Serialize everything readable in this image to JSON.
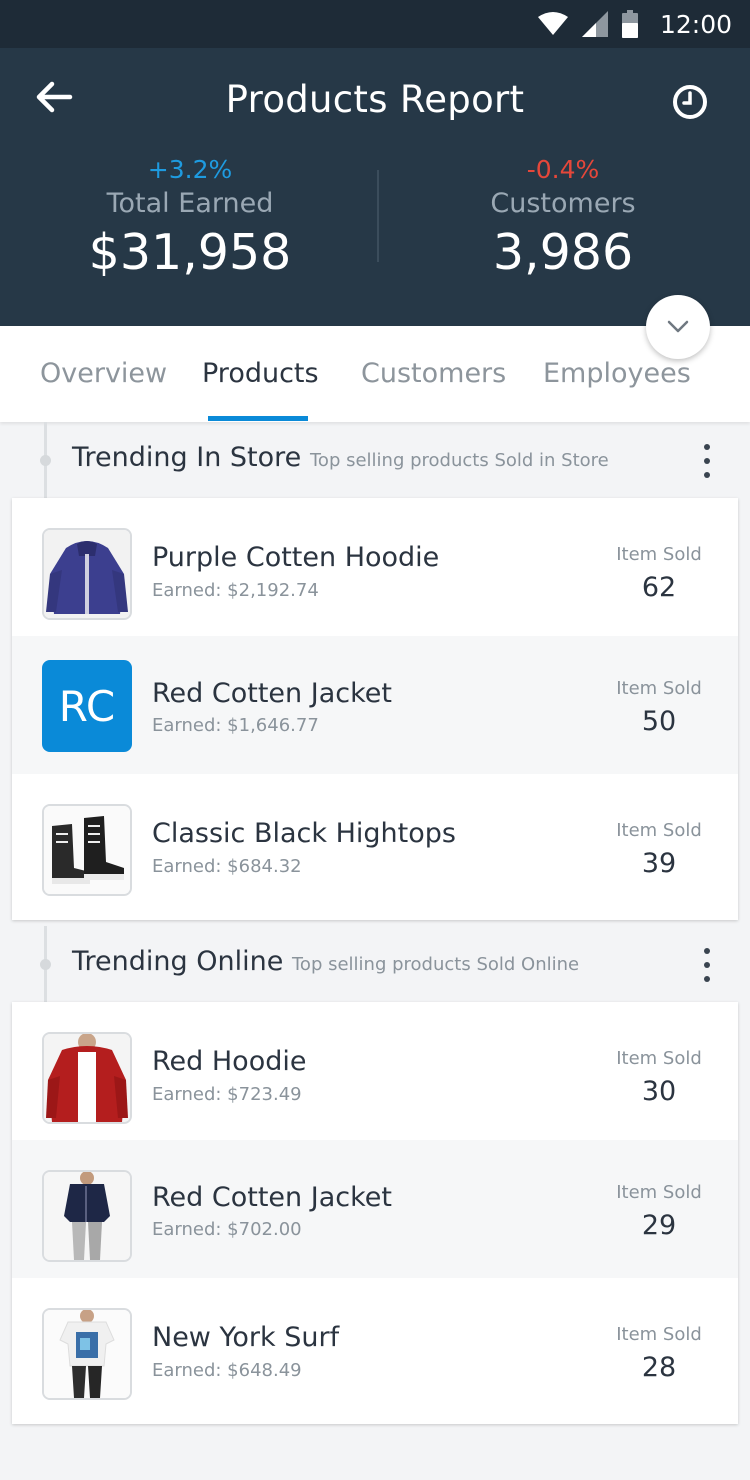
{
  "status_bar": {
    "time": "12:00"
  },
  "header": {
    "title": "Products Report",
    "stats": [
      {
        "change": "+3.2%",
        "change_color": "#1e9be0",
        "label": "Total Earned",
        "value": "$31,958"
      },
      {
        "change": "-0.4%",
        "change_color": "#e5473a",
        "label": "Customers",
        "value": "3,986"
      }
    ]
  },
  "tabs": [
    {
      "label": "Overview",
      "active": false
    },
    {
      "label": "Products",
      "active": true
    },
    {
      "label": "Customers",
      "active": false
    },
    {
      "label": "Employees",
      "active": false
    }
  ],
  "accent_color": "#0a8ad8",
  "sections": [
    {
      "title": "Trending In Store",
      "subtitle": "Top selling products Sold in Store",
      "items": [
        {
          "name": "Purple Cotten Hoodie",
          "earned": "Earned: $2,192.74",
          "sold_label": "Item Sold",
          "sold": "62",
          "image": "purple-hoodie"
        },
        {
          "name": "Red Cotten Jacket",
          "earned": "Earned: $1,646.77",
          "sold_label": "Item Sold",
          "sold": "50",
          "initials": "RC"
        },
        {
          "name": "Classic Black Hightops",
          "earned": "Earned: $684.32",
          "sold_label": "Item Sold",
          "sold": "39",
          "image": "black-hightops"
        }
      ]
    },
    {
      "title": "Trending Online",
      "subtitle": "Top selling products Sold Online",
      "items": [
        {
          "name": "Red Hoodie",
          "earned": "Earned: $723.49",
          "sold_label": "Item Sold",
          "sold": "30",
          "image": "red-hoodie"
        },
        {
          "name": "Red Cotten Jacket",
          "earned": "Earned: $702.00",
          "sold_label": "Item Sold",
          "sold": "29",
          "image": "navy-shirt"
        },
        {
          "name": "New York Surf",
          "earned": "Earned: $648.49",
          "sold_label": "Item Sold",
          "sold": "28",
          "image": "graphic-tee"
        }
      ]
    }
  ]
}
